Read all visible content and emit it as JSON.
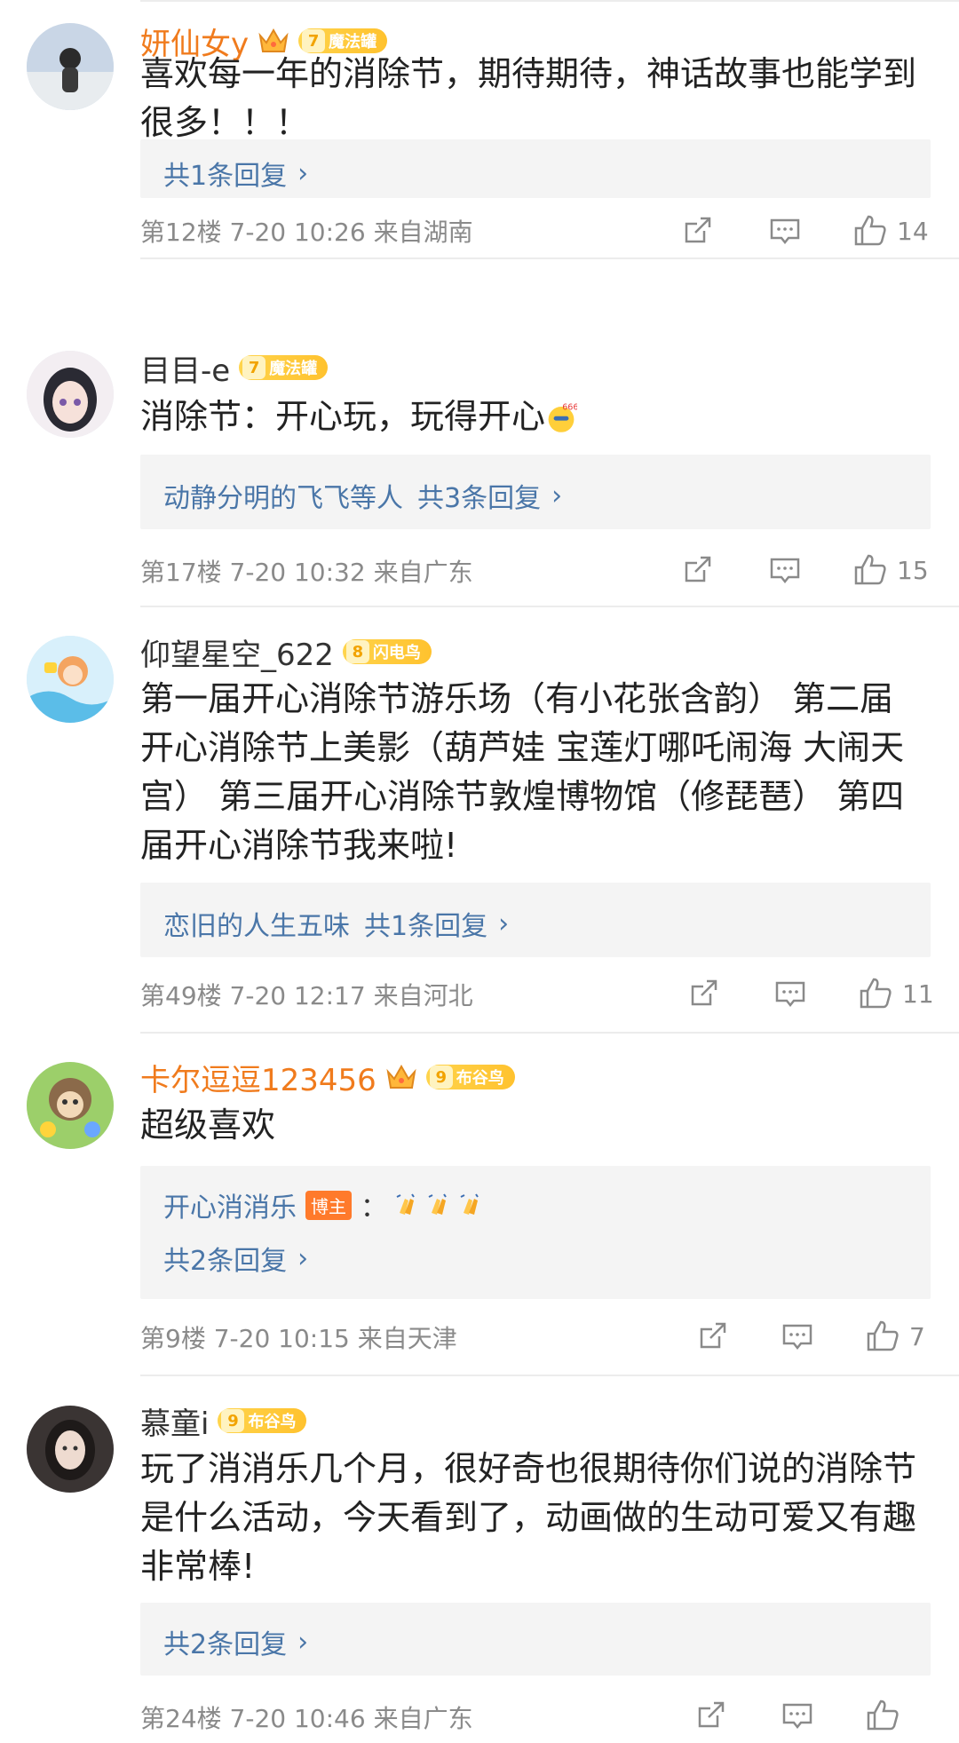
{
  "comments": [
    {
      "username": "妍仙女y",
      "vip": true,
      "badge_level": "7",
      "badge_label": "魔法罐",
      "content": "喜欢每一年的消除节，期待期待，神话故事也能学到很多！！！",
      "reply_summary": "共1条回复",
      "floor": "第12楼",
      "time": "7-20 10:26",
      "location": "来自湖南",
      "likes": "14"
    },
    {
      "username": "目目-e",
      "vip": false,
      "badge_level": "7",
      "badge_label": "魔法罐",
      "content": "消除节：开心玩，玩得开心",
      "reply_users": "动静分明的飞飞等人",
      "reply_summary": "共3条回复",
      "floor": "第17楼",
      "time": "7-20 10:32",
      "location": "来自广东",
      "likes": "15"
    },
    {
      "username": "仰望星空_622",
      "vip": false,
      "badge_level": "8",
      "badge_label": "闪电鸟",
      "content": "第一届开心消除节游乐场（有小花张含韵） 第二届开心消除节上美影（葫芦娃 宝莲灯哪吒闹海 大闹天宫） 第三届开心消除节敦煌博物馆（修琵琶） 第四届开心消除节我来啦!",
      "reply_users": "恋旧的人生五味",
      "reply_summary": "共1条回复",
      "floor": "第49楼",
      "time": "7-20 12:17",
      "location": "来自河北",
      "likes": "11"
    },
    {
      "username": "卡尔逗逗123456",
      "vip": true,
      "badge_level": "9",
      "badge_label": "布谷鸟",
      "content": "超级喜欢",
      "reply_user": "开心消消乐",
      "host_tag": "博主",
      "reply_colon": "：",
      "reply_summary": "共2条回复",
      "floor": "第9楼",
      "time": "7-20 10:15",
      "location": "来自天津",
      "likes": "7"
    },
    {
      "username": "慕童i",
      "vip": false,
      "badge_level": "9",
      "badge_label": "布谷鸟",
      "content": "玩了消消乐几个月，很好奇也很期待你们说的消除节是什么活动，今天看到了，动画做的生动可爱又有趣非常棒!",
      "reply_summary": "共2条回复",
      "floor": "第24楼",
      "time": "7-20 10:46",
      "location": "来自广东",
      "likes": ""
    }
  ],
  "colors": {
    "vip_name": "#f07b1d",
    "reply_link": "#4a76a8",
    "meta": "#8a8a8a",
    "reply_bg": "#f4f4f4"
  },
  "icons": {
    "share": "share-icon",
    "comment": "comment-icon",
    "like": "like-icon",
    "crown": "crown-icon"
  }
}
